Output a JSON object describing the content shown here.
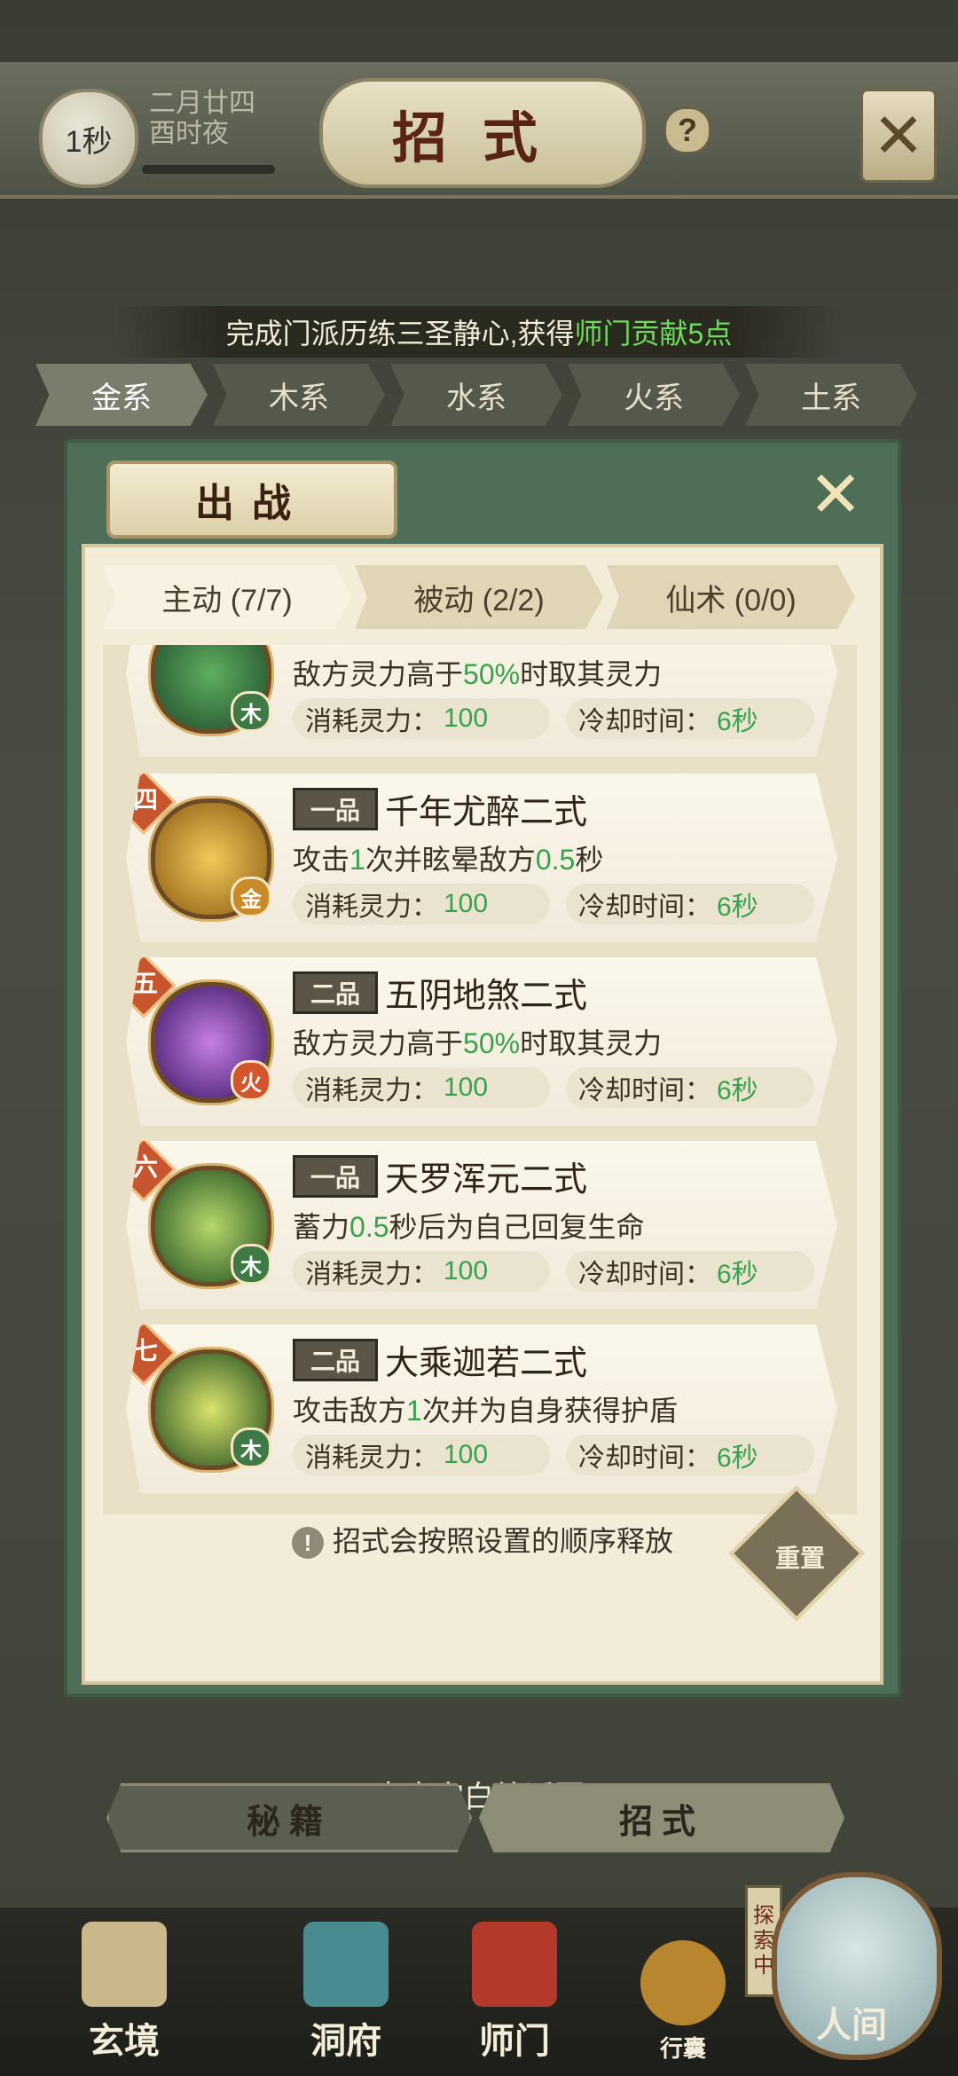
{
  "header": {
    "timer": "1秒",
    "date_line1": "二月廿四",
    "date_line2": "酉时夜",
    "title": "招式",
    "help_icon": "?",
    "close_icon": "✕"
  },
  "notice": {
    "prefix": "完成门派历练三圣静心,获得",
    "highlight": "师门贡献5点"
  },
  "element_tabs": [
    "金系",
    "木系",
    "水系",
    "火系",
    "土系"
  ],
  "modal": {
    "title": "出战",
    "close_icon": "✕",
    "tabs": [
      {
        "label": "主动 (7/7)",
        "active": true
      },
      {
        "label": "被动 (2/2)",
        "active": false
      },
      {
        "label": "仙术 (0/0)",
        "active": false
      }
    ],
    "cards": [
      {
        "rank": "",
        "grade": "",
        "name": "",
        "element": "木",
        "desc_prefix": "敌方灵力高于",
        "desc_num": "50%",
        "desc_suffix": "时取其灵力",
        "cost_label": "消耗灵力：",
        "cost": "100",
        "cd_label": "冷却时间：",
        "cd": "6秒"
      },
      {
        "rank": "四",
        "grade": "一品",
        "name": "千年尤醉二式",
        "element": "金",
        "desc_prefix": "攻击",
        "desc_num": "1",
        "desc_mid": "次并眩晕敌方",
        "desc_num2": "0.5",
        "desc_suffix": "秒",
        "cost_label": "消耗灵力：",
        "cost": "100",
        "cd_label": "冷却时间：",
        "cd": "6秒"
      },
      {
        "rank": "五",
        "grade": "二品",
        "name": "五阴地煞二式",
        "element": "火",
        "desc_prefix": "敌方灵力高于",
        "desc_num": "50%",
        "desc_suffix": "时取其灵力",
        "cost_label": "消耗灵力：",
        "cost": "100",
        "cd_label": "冷却时间：",
        "cd": "6秒"
      },
      {
        "rank": "六",
        "grade": "一品",
        "name": "天罗浑元二式",
        "element": "木",
        "desc_prefix": "蓄力",
        "desc_num": "0.5",
        "desc_suffix": "秒后为自己回复生命",
        "cost_label": "消耗灵力：",
        "cost": "100",
        "cd_label": "冷却时间：",
        "cd": "6秒"
      },
      {
        "rank": "七",
        "grade": "二品",
        "name": "大乘迦若二式",
        "element": "木",
        "desc_prefix": "攻击敌方",
        "desc_num": "1",
        "desc_suffix": "次并为自身获得护盾",
        "cost_label": "消耗灵力：",
        "cost": "100",
        "cd_label": "冷却时间：",
        "cd": "6秒"
      }
    ],
    "hint": "招式会按照设置的顺序释放",
    "hint_icon": "!",
    "reset_label": "重置"
  },
  "tap_return": "点击空白处返回",
  "bottom_tabs": [
    {
      "label": "秘籍",
      "active": false
    },
    {
      "label": "招式",
      "active": true
    }
  ],
  "bottom_nav": {
    "items": [
      "玄境",
      "洞府",
      "师门",
      "行囊",
      "人间"
    ],
    "explore_label": "探索中"
  },
  "colors": {
    "accent_green": "#38a24c",
    "notice_highlight": "#6bdc5c",
    "modal_green": "#4f6e57",
    "rank_badge": "#c7562e"
  }
}
